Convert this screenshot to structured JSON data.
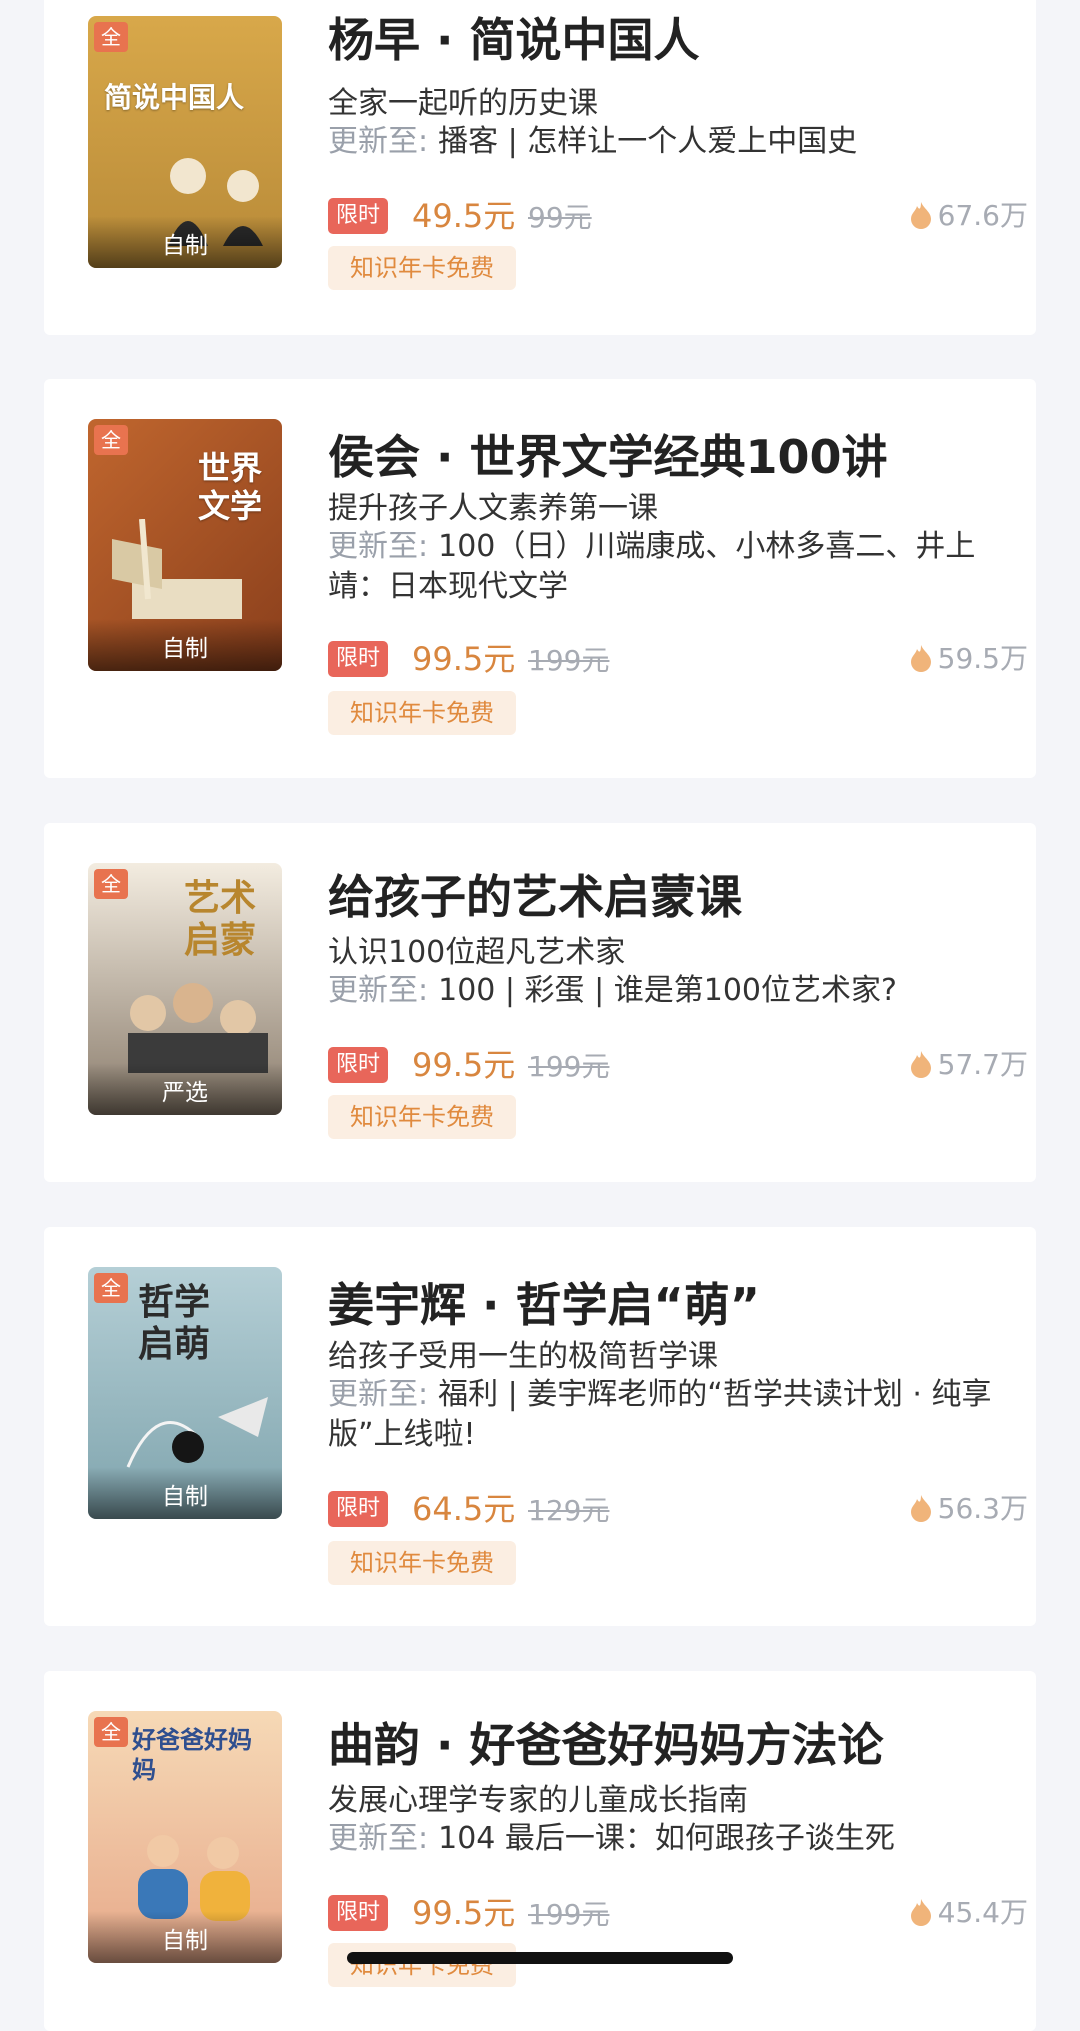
{
  "courses": [
    {
      "title": "杨早 · 简说中国人",
      "subtitle": "全家一起听的历史课",
      "update_label": "更新至:",
      "update_text": "播客 | 怎样让一个人爱上中国史",
      "limit_tag": "限时",
      "price": "49.5元",
      "original_price": "99元",
      "popularity": "67.6万",
      "card_tag": "知识年卡免费",
      "cover": {
        "all_tag": "全",
        "badge": "自制",
        "art_text": "简说中国人",
        "color_top": "#d8a84a",
        "color_bottom": "#b88a38"
      }
    },
    {
      "title": "侯会 · 世界文学经典100讲",
      "subtitle": "提升孩子人文素养第一课",
      "update_label": "更新至:",
      "update_text": "100（日）川端康成、小林多喜二、井上靖：日本现代文学",
      "limit_tag": "限时",
      "price": "99.5元",
      "original_price": "199元",
      "popularity": "59.5万",
      "card_tag": "知识年卡免费",
      "cover": {
        "all_tag": "全",
        "badge": "自制",
        "art_text": "世界文学",
        "color_top": "#c0662e",
        "color_bottom": "#8a3f1c"
      }
    },
    {
      "title": "给孩子的艺术启蒙课",
      "subtitle": "认识100位超凡艺术家",
      "update_label": "更新至:",
      "update_text": "100 | 彩蛋 | 谁是第100位艺术家?",
      "limit_tag": "限时",
      "price": "99.5元",
      "original_price": "199元",
      "popularity": "57.7万",
      "card_tag": "知识年卡免费",
      "cover": {
        "all_tag": "全",
        "badge": "严选",
        "art_text": "艺术启蒙",
        "color_top": "#f3ece0",
        "color_bottom": "#8a7c6c"
      }
    },
    {
      "title": "姜宇辉 · 哲学启“萌”",
      "subtitle": "给孩子受用一生的极简哲学课",
      "update_label": "更新至:",
      "update_text": "福利 | 姜宇辉老师的“哲学共读计划 · 纯享版”上线啦!",
      "limit_tag": "限时",
      "price": "64.5元",
      "original_price": "129元",
      "popularity": "56.3万",
      "card_tag": "知识年卡免费",
      "cover": {
        "all_tag": "全",
        "badge": "自制",
        "art_text": "哲学启萌",
        "color_top": "#a9c6cf",
        "color_bottom": "#7fa4ad"
      }
    },
    {
      "title": "曲韵 · 好爸爸好妈妈方法论",
      "subtitle": "发展心理学专家的儿童成长指南",
      "update_label": "更新至:",
      "update_text": "104 最后一课：如何跟孩子谈生死",
      "limit_tag": "限时",
      "price": "99.5元",
      "original_price": "199元",
      "popularity": "45.4万",
      "card_tag": "知识年卡免费",
      "cover": {
        "all_tag": "全",
        "badge": "自制",
        "art_text": "好爸爸好妈妈",
        "color_top": "#f6d9b6",
        "color_bottom": "#e7a98a"
      }
    }
  ]
}
